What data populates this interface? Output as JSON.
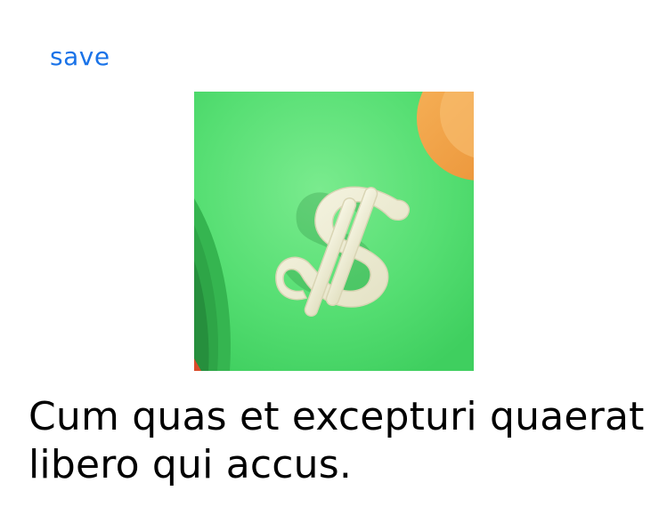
{
  "header": {
    "save_label": "save"
  },
  "hero": {
    "icon": "dollar-sign-icon",
    "colors": {
      "background": "#4fdb6f",
      "symbol": "#efeed6",
      "accent_coin": "#f5a54a"
    }
  },
  "content": {
    "headline": "Cum quas et excepturi quaerat libero qui accus."
  },
  "theme": {
    "link_color": "#1a73e8",
    "text_color": "#000000"
  }
}
